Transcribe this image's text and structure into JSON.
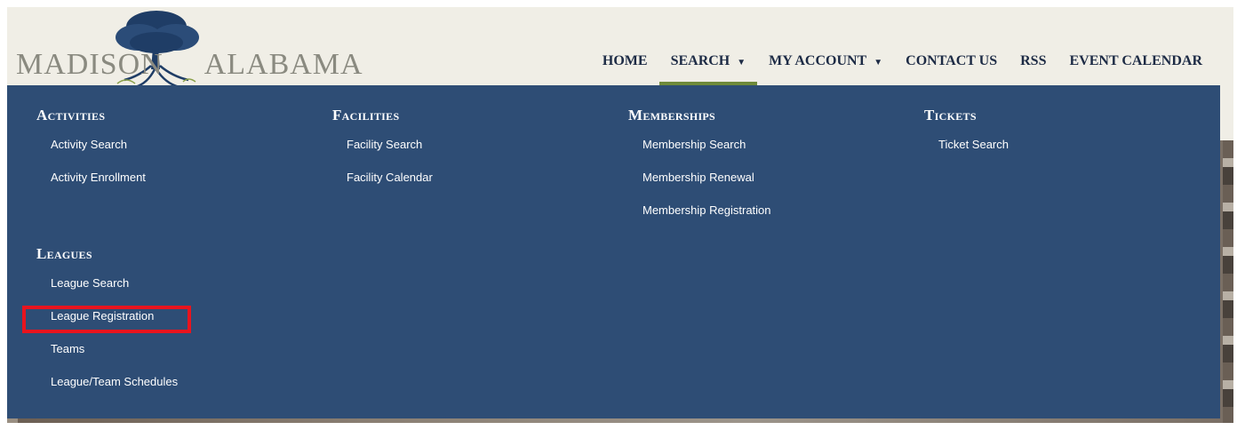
{
  "logo": {
    "left_word": "MADISON",
    "right_word": "ALABAMA"
  },
  "nav": {
    "items": [
      {
        "label": "HOME",
        "caret": false,
        "active": false
      },
      {
        "label": "SEARCH",
        "caret": true,
        "active": true
      },
      {
        "label": "MY ACCOUNT",
        "caret": true,
        "active": false
      },
      {
        "label": "CONTACT US",
        "caret": false,
        "active": false
      },
      {
        "label": "RSS",
        "caret": false,
        "active": false
      },
      {
        "label": "EVENT CALENDAR",
        "caret": false,
        "active": false
      }
    ]
  },
  "menu": {
    "activities": {
      "heading": "Activities",
      "links": [
        "Activity Search",
        "Activity Enrollment"
      ]
    },
    "facilities": {
      "heading": "Facilities",
      "links": [
        "Facility Search",
        "Facility Calendar"
      ]
    },
    "memberships": {
      "heading": "Memberships",
      "links": [
        "Membership Search",
        "Membership Renewal",
        "Membership Registration"
      ]
    },
    "tickets": {
      "heading": "Tickets",
      "links": [
        "Ticket Search"
      ]
    },
    "leagues": {
      "heading": "Leagues",
      "links": [
        "League Search",
        "League Registration",
        "Teams",
        "League/Team Schedules"
      ]
    }
  },
  "colors": {
    "menu_bg": "#2e4d75",
    "active_underline": "#6f8a3a",
    "highlight_border": "#e8141e",
    "nav_text": "#1d2b45"
  }
}
